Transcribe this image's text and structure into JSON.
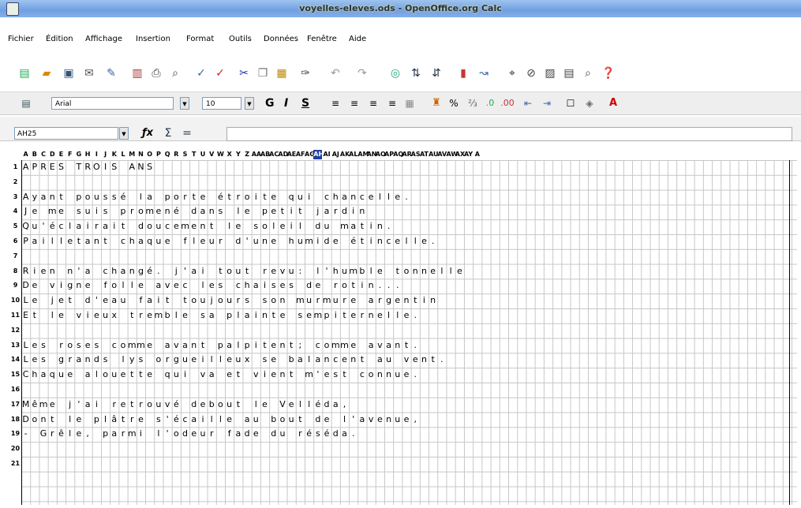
{
  "window": {
    "title": "voyelles-eleves.ods - OpenOffice.org Calc"
  },
  "menu": [
    "Fichier",
    "Édition",
    "Affichage",
    "Insertion",
    "Format",
    "Outils",
    "Données",
    "Fenêtre",
    "Aide"
  ],
  "toolbar2": {
    "font": "Arial",
    "size": "10"
  },
  "formula": {
    "cell_ref": "AH25",
    "value": ""
  },
  "columns": [
    "A",
    "B",
    "C",
    "D",
    "E",
    "F",
    "G",
    "H",
    "I",
    "J",
    "K",
    "L",
    "M",
    "N",
    "O",
    "P",
    "Q",
    "R",
    "S",
    "T",
    "U",
    "V",
    "W",
    "X",
    "Y",
    "Z",
    "AA",
    "AB",
    "AC",
    "AD",
    "AE",
    "AF",
    "AG",
    "AH",
    "AI",
    "AJ",
    "AK",
    "AL",
    "AM",
    "AN",
    "AO",
    "AP",
    "AQ",
    "AR",
    "AS",
    "AT",
    "AU",
    "AV",
    "AW",
    "AX",
    "AY",
    "A"
  ],
  "selected_column": "AH",
  "rows": [
    "1",
    "2",
    "3",
    "4",
    "5",
    "6",
    "7",
    "8",
    "9",
    "10",
    "11",
    "12",
    "13",
    "14",
    "15",
    "16",
    "17",
    "18",
    "19",
    "20",
    "21"
  ],
  "lines": [
    "APRES TROIS ANS",
    "",
    "Ayant poussé la porte étroite qui chancelle.",
    "Je me suis promené dans le petit jardin",
    "Qu'éclairait doucement le soleil du matin.",
    "Pailletant chaque fleur d'une humide étincelle.",
    "",
    "Rien n'a changé. j'ai tout revu: l'humble tonnelle",
    "De vigne folle avec les chaises de rotin...",
    "Le jet d'eau fait toujours son murmure argentin",
    "Et le vieux tremble sa plainte sempiternelle.",
    "",
    "Les roses comme avant palpitent; comme avant.",
    "Les grands lys orgueilleux se balancent au vent.",
    "Chaque alouette qui va et vient m'est connue.",
    "",
    "Même j'ai retrouvé debout le Velléda,",
    "Dont le plâtre s'écaille au bout de l'avenue,",
    "- Grêle, parmi l'odeur fade du réséda.",
    "",
    ""
  ]
}
